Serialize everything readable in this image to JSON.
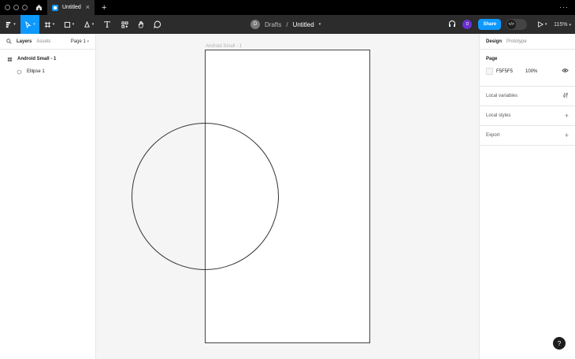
{
  "tabbar": {
    "tab_title": "Untitled",
    "close_glyph": "×",
    "new_tab_glyph": "+",
    "more_glyph": "···"
  },
  "toolbar": {
    "tools": [
      "main-menu",
      "move",
      "frame",
      "shape",
      "pen",
      "text",
      "resources",
      "hand",
      "comment"
    ],
    "text_tool_glyph": "T",
    "location": "Drafts",
    "separator": "/",
    "file_name": "Untitled",
    "file_avatar": "D",
    "user_avatar": "D",
    "share_label": "Share",
    "dev_glyph": "</>",
    "zoom": "115%",
    "chevron": "▾"
  },
  "left_panel": {
    "tab_layers": "Layers",
    "tab_assets": "Assets",
    "page_selector": "Page 1",
    "layers": [
      {
        "name": "Android Small - 1",
        "type": "frame"
      },
      {
        "name": "Ellipse 1",
        "type": "ellipse"
      }
    ]
  },
  "canvas": {
    "frame_label": "Android Small - 1"
  },
  "right_panel": {
    "tab_design": "Design",
    "tab_prototype": "Prototype",
    "page_section_title": "Page",
    "page_fill_hex": "F5F5F5",
    "page_fill_opacity": "100%",
    "local_variables": "Local variables",
    "local_styles": "Local styles",
    "export": "Export",
    "plus_glyph": "+"
  },
  "help_label": "?",
  "colors": {
    "accent": "#0d99ff",
    "user_avatar": "#6b2fd6",
    "canvas_bg": "#F5F5F5"
  }
}
